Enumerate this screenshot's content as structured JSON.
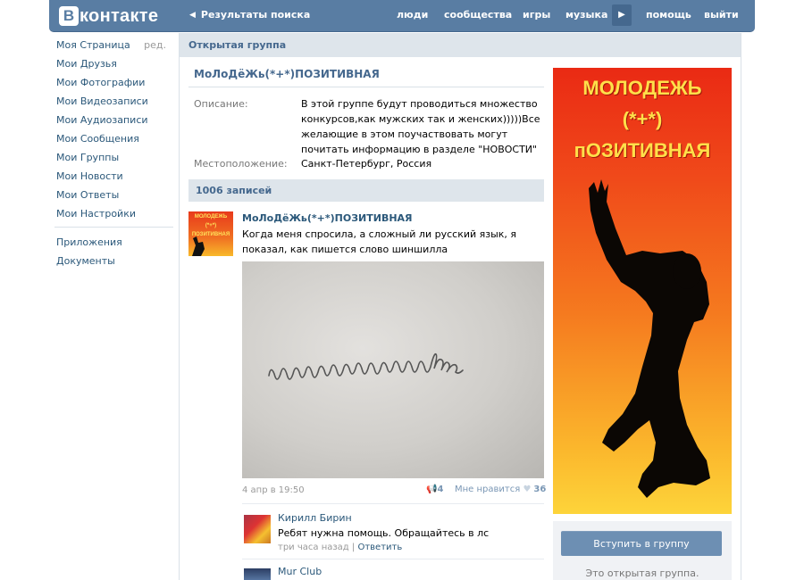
{
  "header": {
    "logo_letter": "B",
    "logo_word": "контакте",
    "back_link": "Результаты поиска",
    "nav": [
      "люди",
      "сообщества",
      "игры",
      "музыка",
      "помощь",
      "выйти"
    ]
  },
  "sidebar": {
    "items": [
      "Моя Страница",
      "Мои Друзья",
      "Мои Фотографии",
      "Мои Видеозаписи",
      "Мои Аудиозаписи",
      "Мои Сообщения",
      "Мои Группы",
      "Мои Новости",
      "Мои Ответы",
      "Мои Настройки"
    ],
    "edit_label": "ред.",
    "extra": [
      "Приложения",
      "Документы"
    ]
  },
  "group": {
    "header": "Открытая группа",
    "title": "МоЛоДёЖь(*+*)ПОЗИТИВНАЯ",
    "desc_label": "Описание:",
    "desc_value": "В этой группе будут проводиться множество конкурсов,как мужских так и женских)))))Все желающие в этом поучаствовать могут почитать информацию в разделе \"НОВОСТИ\"",
    "loc_label": "Местоположение:",
    "loc_value": "Санкт-Петербург, Россия",
    "records": "1006 записей"
  },
  "post": {
    "avatar_lines": [
      "МОЛОДЕЖЬ",
      "(*+*)",
      "ПОЗИТИВНАЯ"
    ],
    "author": "МоЛоДёЖь(*+*)ПОЗИТИВНАЯ",
    "text": "Когда меня спросила, а сложный ли русский язык, я показал, как пишется слово шиншилла",
    "image_text": "шиншилла",
    "date": "4 апр в 19:50",
    "shares": "4",
    "like_label": "Мне нравится",
    "likes": "36"
  },
  "comments": [
    {
      "name": "Кирилл Бирин",
      "text": "Ребят нужна помощь. Обращайтесь в лс",
      "time": "три часа назад",
      "sep": "|",
      "reply": "Ответить"
    },
    {
      "name": "Mur Club"
    }
  ],
  "banner": {
    "lines": [
      "МОЛОДЕЖЬ",
      "(*+*)",
      "пОЗИТИВНАЯ"
    ]
  },
  "join": {
    "button": "Вступить в группу",
    "note": "Это открытая группа."
  }
}
